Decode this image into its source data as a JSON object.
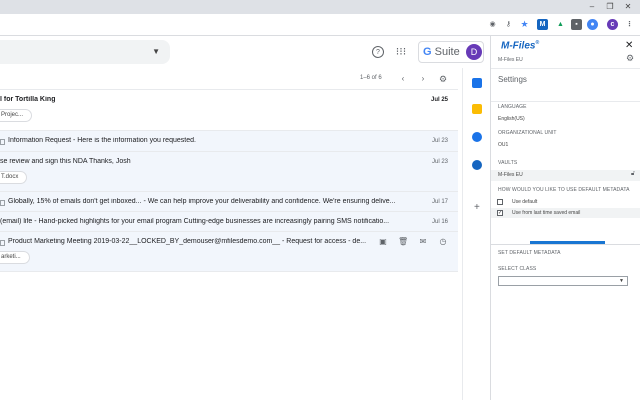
{
  "gmail": {
    "gsuite_label_g": "G",
    "gsuite_label_suite": " Suite",
    "avatar_letter": "D",
    "pager": "1–6 of 6",
    "emails": [
      {
        "subject": "l for Tortilla King",
        "date": "Jul 25",
        "chip": "Projec...",
        "unread": true
      },
      {
        "subject": "Information Request - Here is the information you requested.",
        "date": "Jul 23",
        "attach": true
      },
      {
        "subject": "se review and sign this NDA Thanks, Josh",
        "date": "Jul 23",
        "chip": "T.docx"
      },
      {
        "subject": "Globally, 15% of emails don't get inboxed... - We can help improve your deliverability and confidence. We're ensuring delive...",
        "date": "Jul 17",
        "attach": true
      },
      {
        "subject": "(email) life - Hand-picked highlights for your email program Cutting-edge businesses are increasingly pairing SMS notificatio...",
        "date": "Jul 16"
      },
      {
        "subject": "Product Marketing Meeting 2019-03-22__LOCKED_BY_demouser@mfilesdemo.com__ - Request for access - de...",
        "chip": "arketi...",
        "attach": true
      }
    ]
  },
  "mfiles": {
    "logo": "M-Files",
    "logo_mark": "®",
    "vault_sub": "M-Files EU",
    "settings_title": "Settings",
    "language_label": "LANGUAGE",
    "language_value": "English(US)",
    "org_unit_label": "ORGANIZATIONAL UNIT",
    "org_unit_value": "OU1",
    "vaults_label": "VAULTS",
    "vault_value": "M-Files EU",
    "default_meta_question": "HOW WOULD YOU LIKE TO USE DEFAULT METADATA",
    "option_use_default": "Use default",
    "option_last_saved": "Use from last time saved email",
    "set_default_label": "SET DEFAULT METADATA",
    "select_class_label": "SELECT CLASS"
  },
  "colors": {
    "mfiles_blue": "#1565c0",
    "avatar_purple": "#673ab7",
    "progress_blue": "#1976d2"
  }
}
